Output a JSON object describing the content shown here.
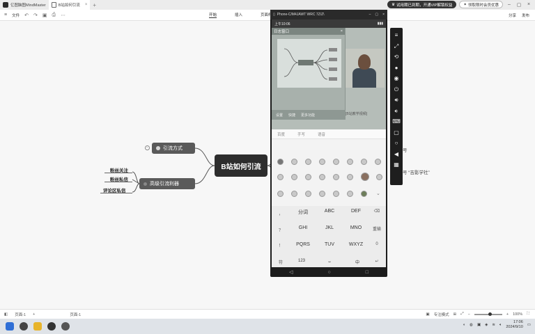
{
  "titlebar": {
    "app_tab": "亿图脑图MindMaster",
    "doc_tab": "B站如何引流",
    "upgrade_pill": "试用期已到期，开通VIP解锁权益",
    "member_pill": "领取限时会员优惠"
  },
  "menubar": {
    "file": "文件",
    "tabs": [
      "开始",
      "插入",
      "页面样式"
    ],
    "right": [
      "分享",
      "发布"
    ]
  },
  "mindmap": {
    "root": "B站如何引流",
    "branches": [
      {
        "label": "引流方式"
      },
      {
        "label": "高级引流利器",
        "leaves": [
          "粉丝关注",
          "粉丝私信",
          "评论区私信"
        ]
      }
    ],
    "side_notes": [
      "号",
      "号 “吉影学社”"
    ]
  },
  "phone": {
    "window_title": "Phone-C/M4JAWT WRC 7Z/Z\\",
    "status_time": "上午10:06",
    "mini_window_title": "日志窗口",
    "mini_bar_items": [
      "设置",
      "快捷",
      "更多功能"
    ],
    "video_caption": "[B站教学视频]",
    "input_row": [
      "百度",
      "手写",
      "语音"
    ],
    "keyboard": {
      "row1": [
        "分词",
        "ABC",
        "DEF"
      ],
      "row2": [
        "GHI",
        "JKL",
        "MNO"
      ],
      "row3": [
        "PQRS",
        "TUV",
        "WXYZ"
      ],
      "row4": [
        "符",
        "123",
        "",
        "中"
      ],
      "side_left": [
        "，",
        "？",
        "！"
      ],
      "side_right": [
        "⌫",
        "重输",
        "0",
        "↵"
      ]
    }
  },
  "statusbar": {
    "page": "页面-1",
    "page2": "页面-1",
    "focus": "专注模式",
    "zoom": "100%"
  },
  "taskbar": {
    "time": "17:06",
    "date": "2024/9/10"
  },
  "colors": {
    "root_bg": "#2d2d2d",
    "branch_bg": "#5a5a5a",
    "canvas_bg": "#f7f7f7"
  }
}
